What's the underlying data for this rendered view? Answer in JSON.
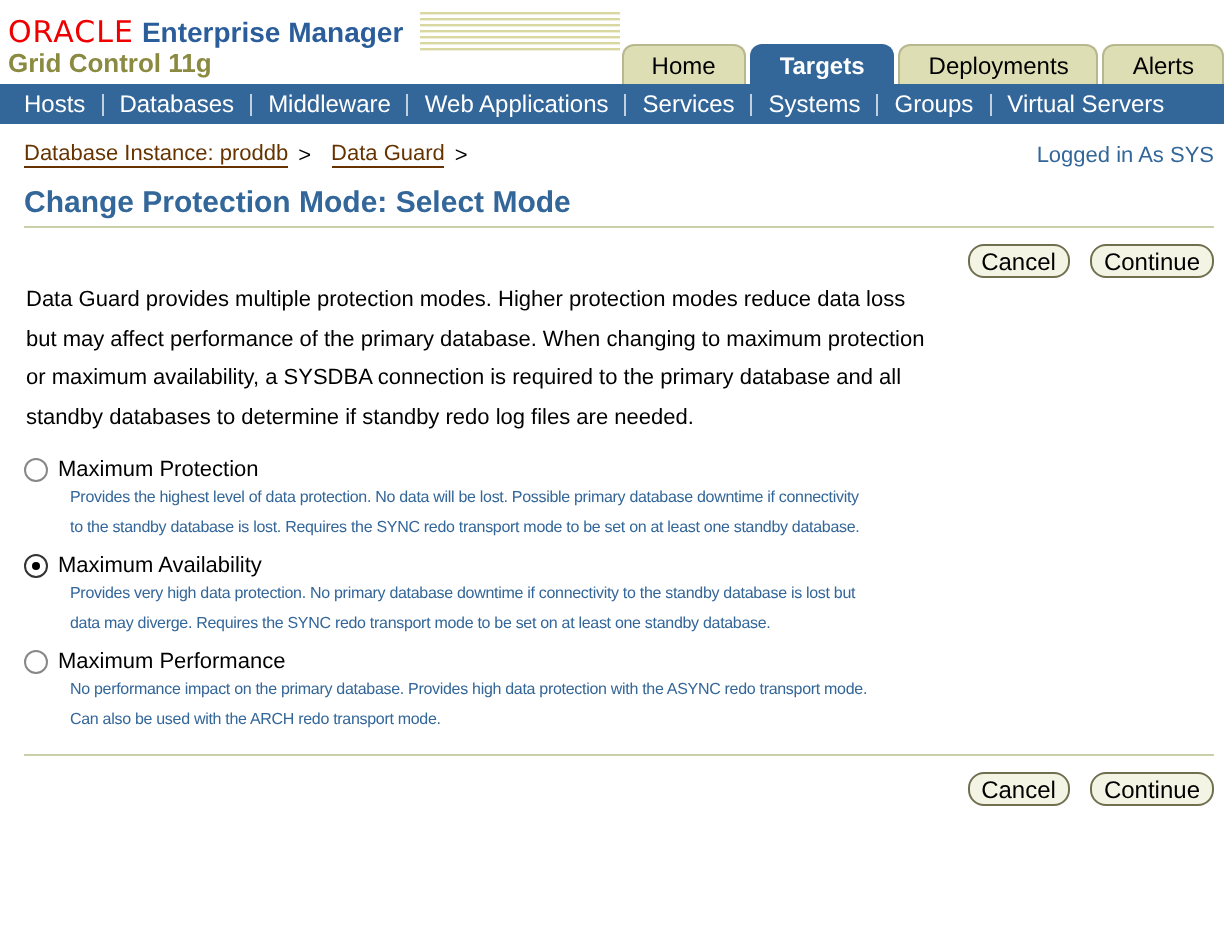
{
  "brand": {
    "logo": "ORACLE",
    "product": "Enterprise Manager",
    "subtitle": "Grid Control 11g"
  },
  "tabs": [
    {
      "label": "Home",
      "selected": false
    },
    {
      "label": "Targets",
      "selected": true
    },
    {
      "label": "Deployments",
      "selected": false
    },
    {
      "label": "Alerts",
      "selected": false
    }
  ],
  "nav": [
    "Hosts",
    "Databases",
    "Middleware",
    "Web Applications",
    "Services",
    "Systems",
    "Groups",
    "Virtual Servers"
  ],
  "breadcrumbs": [
    "Database Instance: proddb",
    "Data Guard"
  ],
  "breadcrumb_separator": ">",
  "login_status": "Logged in As SYS",
  "page_title": "Change Protection Mode: Select Mode",
  "buttons": [
    "Cancel",
    "Continue"
  ],
  "intro": "Data Guard provides multiple protection modes. Higher protection modes reduce data loss but may affect performance of the primary database. When changing to maximum protection or maximum availability, a SYSDBA connection is required to the primary database and all standby databases to determine if standby redo log files are needed.",
  "modes": [
    {
      "label": "Maximum Protection",
      "selected": false,
      "description": "Provides the highest level of data protection. No data will be lost. Possible primary database downtime if connectivity to the standby database is lost. Requires the SYNC redo transport mode to be set on at least one standby database."
    },
    {
      "label": "Maximum Availability",
      "selected": true,
      "description": "Provides very high data protection. No primary database downtime if connectivity to the standby database is lost but data may diverge. Requires the SYNC redo transport mode to be set on at least one standby database."
    },
    {
      "label": "Maximum Performance",
      "selected": false,
      "description": "No performance impact on the primary database. Provides high data protection with the ASYNC redo transport mode. Can also be used with the ARCH redo transport mode."
    }
  ],
  "bottom_buttons": [
    "Cancel",
    "Continue"
  ]
}
